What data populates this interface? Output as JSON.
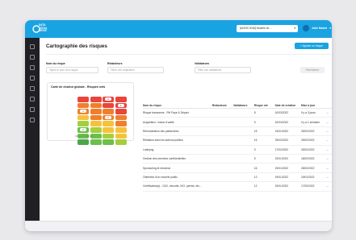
{
  "app": {
    "logo_text": [
      "DATA",
      "LEGAL",
      "DRIVE"
    ]
  },
  "header": {
    "workspace": "[ANSSI 2048] Modèle de ...",
    "user": "Julie Martel",
    "chevron": "▾"
  },
  "sidebar": {
    "icons": [
      "home-icon",
      "dashboard-icon",
      "folder-icon",
      "document-icon",
      "shield-icon",
      "chart-icon",
      "people-icon",
      "settings-icon"
    ]
  },
  "page": {
    "title": "Cartographie des risques",
    "add_button": "+ Ajouter un risque"
  },
  "filters": {
    "name_label": "Nom du risque",
    "name_placeholder": "Tapez le nom d'un risque",
    "editors_label": "Rédacteurs",
    "editors_placeholder": "Filtrer ces rédacteurs",
    "validators_label": "Validateurs",
    "validators_placeholder": "Filtre ces validateurs",
    "reset_button": "Réinitialiser"
  },
  "heatmap_card": {
    "title": "Carte de chaleur globale - Risques nets",
    "axis_caption": "NIVEAU D'IMPACT",
    "rows": [
      [
        {
          "color": "#e8453c",
          "badge": ""
        },
        {
          "color": "#e8453c",
          "badge": ""
        },
        {
          "color": "#e8453c",
          "badge": "4"
        },
        {
          "color": "#e8453c",
          "badge": ""
        }
      ],
      [
        {
          "color": "#f07f2d",
          "badge": ""
        },
        {
          "color": "#f07f2d",
          "badge": ""
        },
        {
          "color": "#e8453c",
          "badge": ""
        },
        {
          "color": "#e8453c",
          "badge": "2"
        }
      ],
      [
        {
          "color": "#f07f2d",
          "badge": "1"
        },
        {
          "color": "#f07f2d",
          "badge": ""
        },
        {
          "color": "#f07f2d",
          "badge": ""
        },
        {
          "color": "#e8453c",
          "badge": ""
        }
      ],
      [
        {
          "color": "#f5c33b",
          "badge": ""
        },
        {
          "color": "#f07f2d",
          "badge": ""
        },
        {
          "color": "#f07f2d",
          "badge": "1"
        },
        {
          "color": "#f07f2d",
          "badge": ""
        }
      ],
      [
        {
          "color": "#a5cf3c",
          "badge": ""
        },
        {
          "color": "#f5c33b",
          "badge": ""
        },
        {
          "color": "#f5c33b",
          "badge": ""
        },
        {
          "color": "#f07f2d",
          "badge": ""
        }
      ],
      [
        {
          "color": "#6cbf4a",
          "badge": "2"
        },
        {
          "color": "#a5cf3c",
          "badge": ""
        },
        {
          "color": "#f5c33b",
          "badge": ""
        },
        {
          "color": "#f5c33b",
          "badge": ""
        }
      ],
      [
        {
          "color": "#6cbf4a",
          "badge": ""
        },
        {
          "color": "#6cbf4a",
          "badge": ""
        },
        {
          "color": "#a5cf3c",
          "badge": ""
        },
        {
          "color": "#f5c33b",
          "badge": ""
        }
      ],
      [
        {
          "color": "#4aa84a",
          "badge": ""
        },
        {
          "color": "#6cbf4a",
          "badge": ""
        },
        {
          "color": "#6cbf4a",
          "badge": ""
        },
        {
          "color": "#a5cf3c",
          "badge": ""
        }
      ]
    ]
  },
  "table": {
    "headers": [
      "Nom du risque",
      "Rédacteurs",
      "Validateurs",
      "Risque net",
      "Date de création",
      "Mise à jour",
      ""
    ],
    "rows": [
      [
        "Risque transverse - RH Paye & Départ",
        "",
        "",
        "8",
        "10/03/2022",
        "Il y a 3 jours",
        "..."
      ],
      [
        "Acquisition / fusion d'actifs",
        "",
        "",
        "9",
        "10/03/2022",
        "Il y a 1 semaine",
        "..."
      ],
      [
        "Rémunération des partenaires",
        "",
        "",
        "15",
        "24/01/2022",
        "25/02/2022",
        "..."
      ],
      [
        "Relations avec les acteurs publics",
        "",
        "",
        "16",
        "25/02/2022",
        "25/02/2022",
        "..."
      ],
      [
        "Lobbying",
        "",
        "",
        "9",
        "17/02/2022",
        "25/02/2022",
        "..."
      ],
      [
        "Gestion des données confidentielles",
        "",
        "",
        "5",
        "22/01/2022",
        "18/02/2022",
        "..."
      ],
      [
        "Sponsoring et mécénat",
        "",
        "",
        "16",
        "19/01/2022",
        "25/02/2022",
        "..."
      ],
      [
        "Obtention d'un marché public",
        "",
        "",
        "12",
        "19/01/2022",
        "19/01/2022",
        "..."
      ],
      [
        "Certification(s) - CAC, sécurité, ISO, permis, etc...",
        "",
        "",
        "12",
        "19/01/2022",
        "17/02/2022",
        "..."
      ]
    ]
  }
}
